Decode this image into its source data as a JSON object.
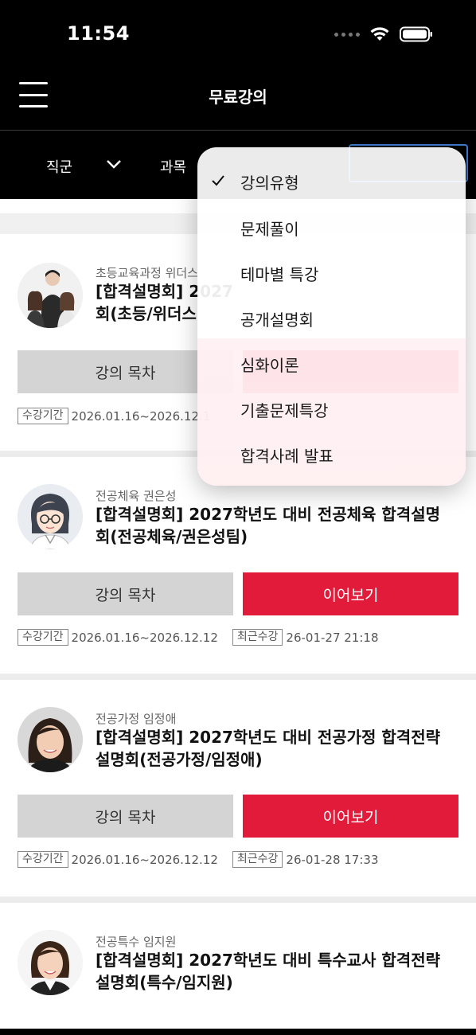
{
  "status": {
    "time": "11:54"
  },
  "header": {
    "title": "무료강의"
  },
  "filters": [
    {
      "label": "직군"
    },
    {
      "label": "과목"
    }
  ],
  "dropdown": {
    "selected_index": 0,
    "items": [
      "강의유형",
      "문제풀이",
      "테마별 특강",
      "공개설명회",
      "심화이론",
      "기출문제특강",
      "합격사례 발표"
    ]
  },
  "courses": [
    {
      "subtitle": "초등교육과정 위더스",
      "title_line1": "[합격설명회] 2027",
      "title_line2": "회(초등/위더스",
      "toc_label": "강의 목차",
      "continue_label": "",
      "period_label": "수강기간",
      "period": "2026.01.16~2026.12.1"
    },
    {
      "subtitle": "전공체육 권은성",
      "title_line1": "[합격설명회] 2027학년도 대비 전공체육 합격설명",
      "title_line2": "회(전공체육/권은성팀)",
      "toc_label": "강의 목차",
      "continue_label": "이어보기",
      "period_label": "수강기간",
      "period": "2026.01.16~2026.12.12",
      "recent_label": "최근수강",
      "recent": "26-01-27 21:18"
    },
    {
      "subtitle": "전공가정 임정애",
      "title_line1": "[합격설명회] 2027학년도 대비 전공가정 합격전략",
      "title_line2": "설명회(전공가정/임정애)",
      "toc_label": "강의 목차",
      "continue_label": "이어보기",
      "period_label": "수강기간",
      "period": "2026.01.16~2026.12.12",
      "recent_label": "최근수강",
      "recent": "26-01-28 17:33"
    },
    {
      "subtitle": "전공특수 임지원",
      "title_line1": "[합격설명회] 2027학년도 대비 특수교사 합격전략",
      "title_line2": "설명회(특수/임지원)"
    }
  ],
  "colors": {
    "accent": "#e31b3a",
    "header_bg": "#000000",
    "button_gray": "#d4d4d4"
  },
  "icons": [
    "hamburger-menu-icon",
    "chevron-down-icon",
    "checkmark-icon",
    "wifi-icon",
    "battery-icon",
    "signal-dots-icon"
  ]
}
